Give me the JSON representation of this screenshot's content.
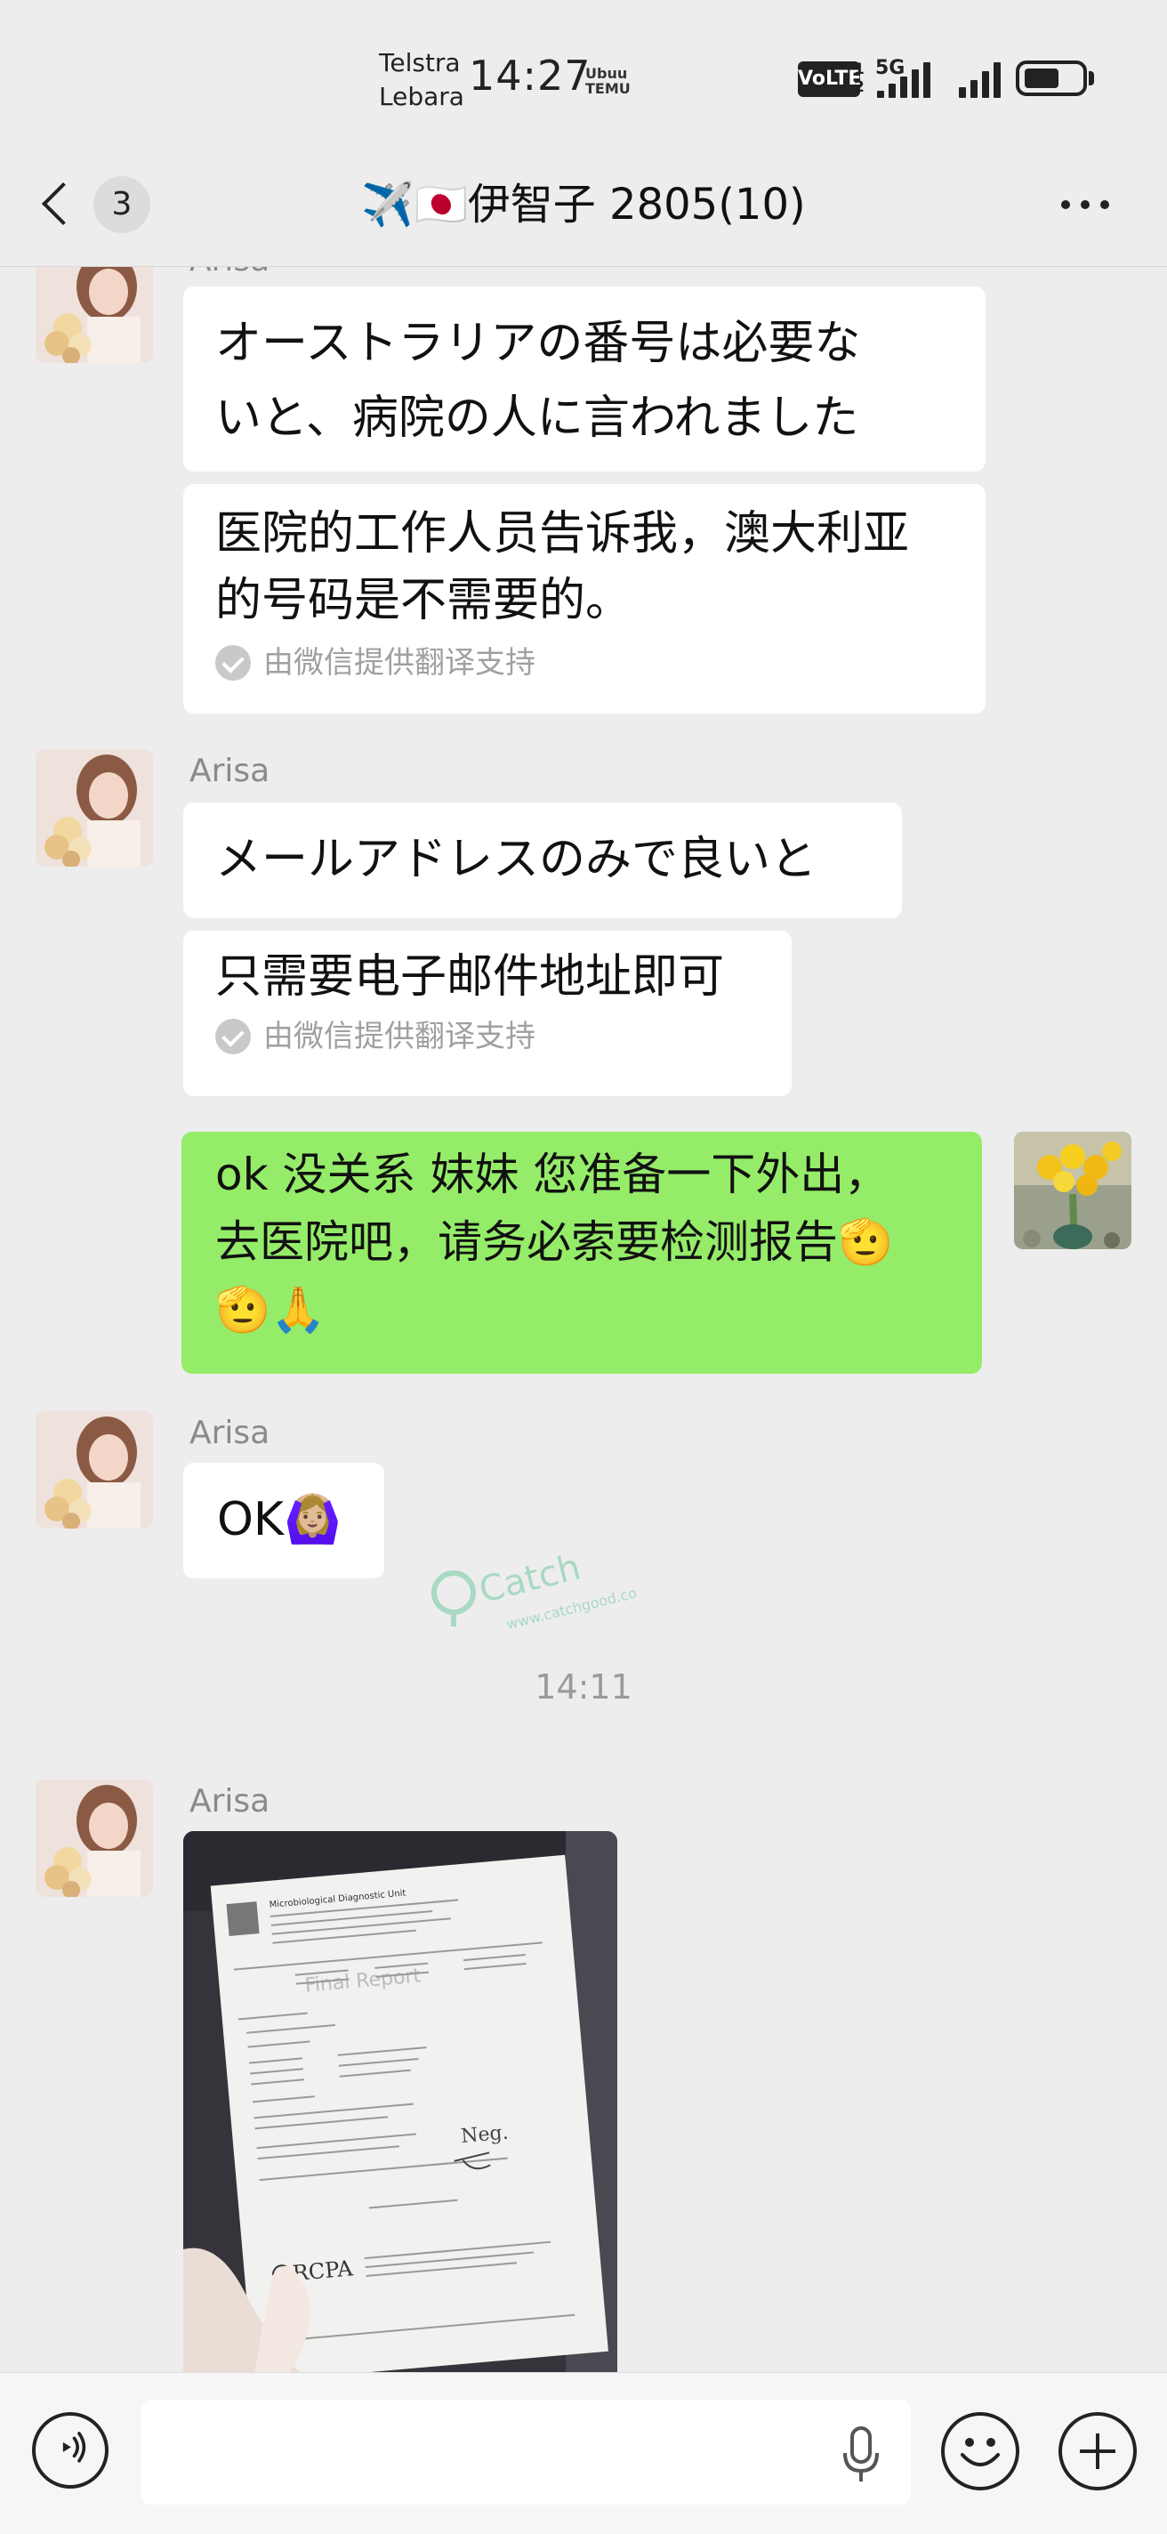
{
  "status_bar": {
    "carrier_1": "Telstra",
    "carrier_2": "Lebara",
    "time": "14:27",
    "time_badge_1": "Ubuu",
    "time_badge_2": "TEMU",
    "volte": "VoLTE",
    "sim_1": "1",
    "sim_2": "2",
    "network": "5G",
    "battery_level": 0.6
  },
  "nav": {
    "unread_count": "3",
    "title": "✈️🇯🇵伊智子 2805(10)"
  },
  "messages": {
    "m1": {
      "sender": "Arisa",
      "text_line1": "オーストラリアの番号は必要な",
      "text_line2": "いと、病院の人に言われました",
      "translation_line1": "医院的工作人员告诉我，澳大利亚",
      "translation_line2": "的号码是不需要的。",
      "translation_note": "由微信提供翻译支持"
    },
    "m2": {
      "sender": "Arisa",
      "text": "メールアドレスのみで良いと",
      "translation": "只需要电子邮件地址即可",
      "translation_note": "由微信提供翻译支持"
    },
    "m3": {
      "line1": "ok 没关系 妹妹 您准备一下外出，",
      "line2": "去医院吧，请务必索要检测报告🫡",
      "line3": "🫡🙏"
    },
    "m4": {
      "sender": "Arisa",
      "text": "OK🙆🏼‍♀️"
    },
    "timestamp": "14:11",
    "m5": {
      "sender": "Arisa",
      "photo_title": "Microbiological Diagnostic Unit",
      "photo_subtitle": "Final Report",
      "photo_logo": "RCPA",
      "photo_note": "Neg."
    }
  },
  "watermark": {
    "brand": "Catch",
    "url": "www.catchgood.co"
  },
  "input_bar": {
    "placeholder": ""
  }
}
